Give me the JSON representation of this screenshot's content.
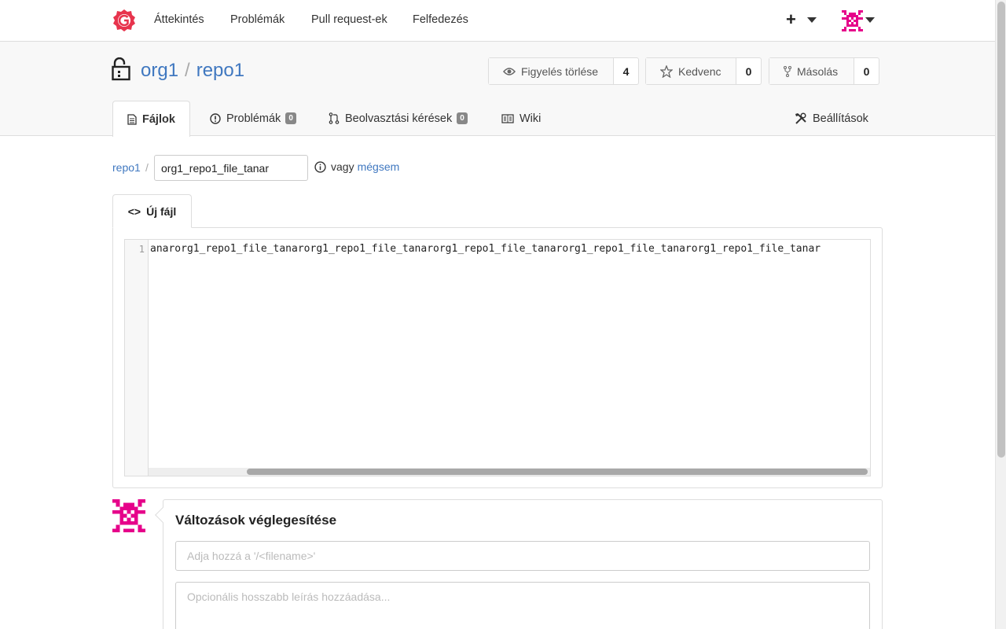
{
  "nav": {
    "items": [
      "Áttekintés",
      "Problémák",
      "Pull request-ek",
      "Felfedezés"
    ],
    "plus": "+"
  },
  "repo": {
    "owner": "org1",
    "separator": "/",
    "name": "repo1",
    "watch": {
      "label": "Figyelés törlése",
      "count": "4"
    },
    "star": {
      "label": "Kedvenc",
      "count": "0"
    },
    "fork": {
      "label": "Másolás",
      "count": "0"
    }
  },
  "tabs": {
    "files": "Fájlok",
    "issues": {
      "label": "Problémák",
      "count": "0"
    },
    "pulls": {
      "label": "Beolvasztási kérések",
      "count": "0"
    },
    "wiki": "Wiki",
    "settings": "Beállítások"
  },
  "breadcrumb": {
    "repo": "repo1",
    "separator": "/",
    "filename_value": "org1_repo1_file_tanar",
    "or_text": "vagy",
    "cancel": "mégsem"
  },
  "editor": {
    "tab_label": "Új fájl",
    "line_number": "1",
    "line_text": "anarorg1_repo1_file_tanarorg1_repo1_file_tanarorg1_repo1_file_tanarorg1_repo1_file_tanarorg1_repo1_file_tanar"
  },
  "commit": {
    "title": "Változások véglegesítése",
    "summary_placeholder": "Adja hozzá a '/<filename>'",
    "description_placeholder": "Opcionális hosszabb leírás hozzáadása..."
  },
  "colors": {
    "link": "#4078c0",
    "logo": "#e7344d",
    "avatar": "#e6008a"
  }
}
